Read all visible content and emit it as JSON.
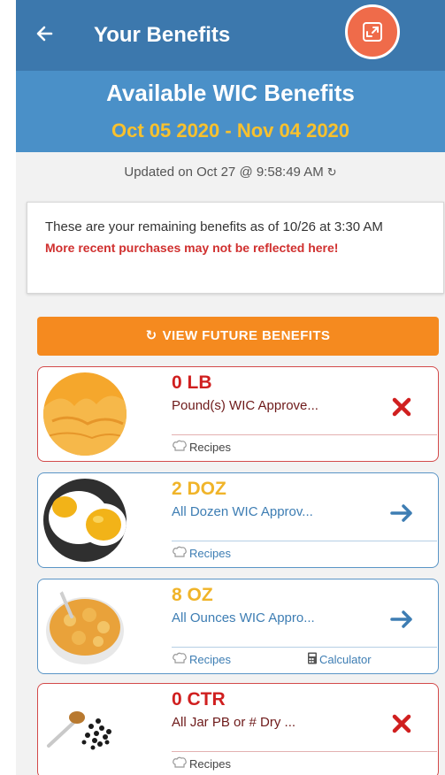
{
  "header": {
    "title": "Your Benefits",
    "back_icon": "arrow-left-icon",
    "expand_icon": "expand-icon",
    "accent_color": "#ef6b4a"
  },
  "banner": {
    "title": "Available WIC Benefits",
    "dates": "Oct 05 2020 - Nov 04 2020"
  },
  "updated": {
    "text": "Updated on Oct 27 @ 9:58:49 AM",
    "refresh_icon": "refresh-icon"
  },
  "notice": {
    "text": "These are your remaining benefits as of 10/26 at 3:30 AM",
    "warning": "More recent purchases may not be reflected here!"
  },
  "future_button": {
    "label": "VIEW FUTURE BENEFITS",
    "icon": "refresh-icon"
  },
  "benefits": [
    {
      "quantity": "0 LB",
      "description": "Pound(s) WIC Approve...",
      "status": "empty",
      "image": "cheese",
      "action_icon": "close-icon",
      "recipes_label": "Recipes"
    },
    {
      "quantity": "2 DOZ",
      "description": "All Dozen WIC Approv...",
      "status": "available",
      "image": "eggs",
      "action_icon": "arrow-right-icon",
      "recipes_label": "Recipes"
    },
    {
      "quantity": "8 OZ",
      "description": "All Ounces WIC Appro...",
      "status": "available",
      "image": "cereal",
      "action_icon": "arrow-right-icon",
      "recipes_label": "Recipes",
      "calculator_label": "Calculator"
    },
    {
      "quantity": "0 CTR",
      "description": "All Jar PB or # Dry ...",
      "status": "empty",
      "image": "beans",
      "action_icon": "close-icon",
      "recipes_label": "Recipes"
    }
  ],
  "colors": {
    "topbar": "#3c78ad",
    "banner": "#4a90c8",
    "dates": "#f8c12e",
    "warning": "#d0302f",
    "future_button": "#f58a1f",
    "empty": "#d01f1f",
    "available_qty": "#f0b429",
    "available_text": "#3d7db3"
  }
}
